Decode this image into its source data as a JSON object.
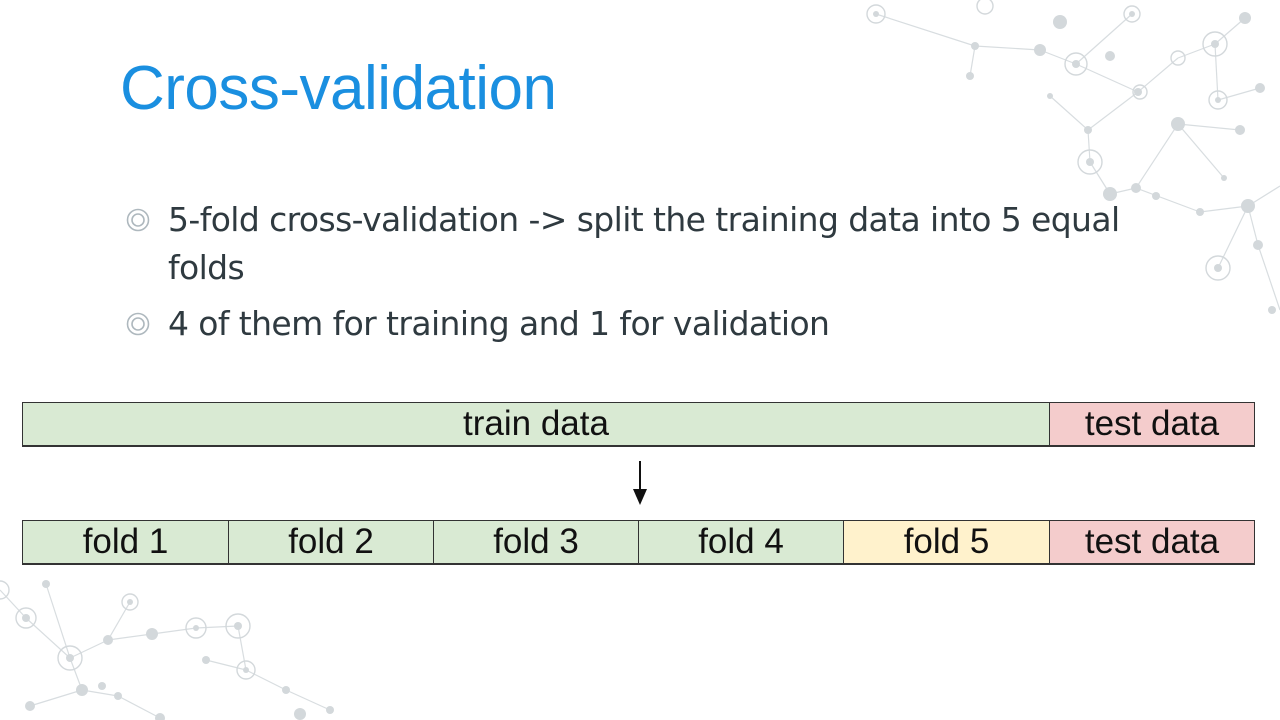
{
  "slide": {
    "title": "Cross-validation",
    "bullets": [
      "5-fold cross-validation -> split the training data into 5 equal folds",
      "4 of them for training and 1 for validation"
    ]
  },
  "diagram": {
    "top_row": {
      "train_label": "train data",
      "test_label": "test data"
    },
    "bottom_row": {
      "folds": [
        "fold 1",
        "fold 2",
        "fold 3",
        "fold 4",
        "fold 5"
      ],
      "test_label": "test data"
    },
    "colors": {
      "train": "#d9ead3",
      "validation": "#fff2cc",
      "test": "#f4cccc",
      "title": "#1a8fe0"
    }
  }
}
